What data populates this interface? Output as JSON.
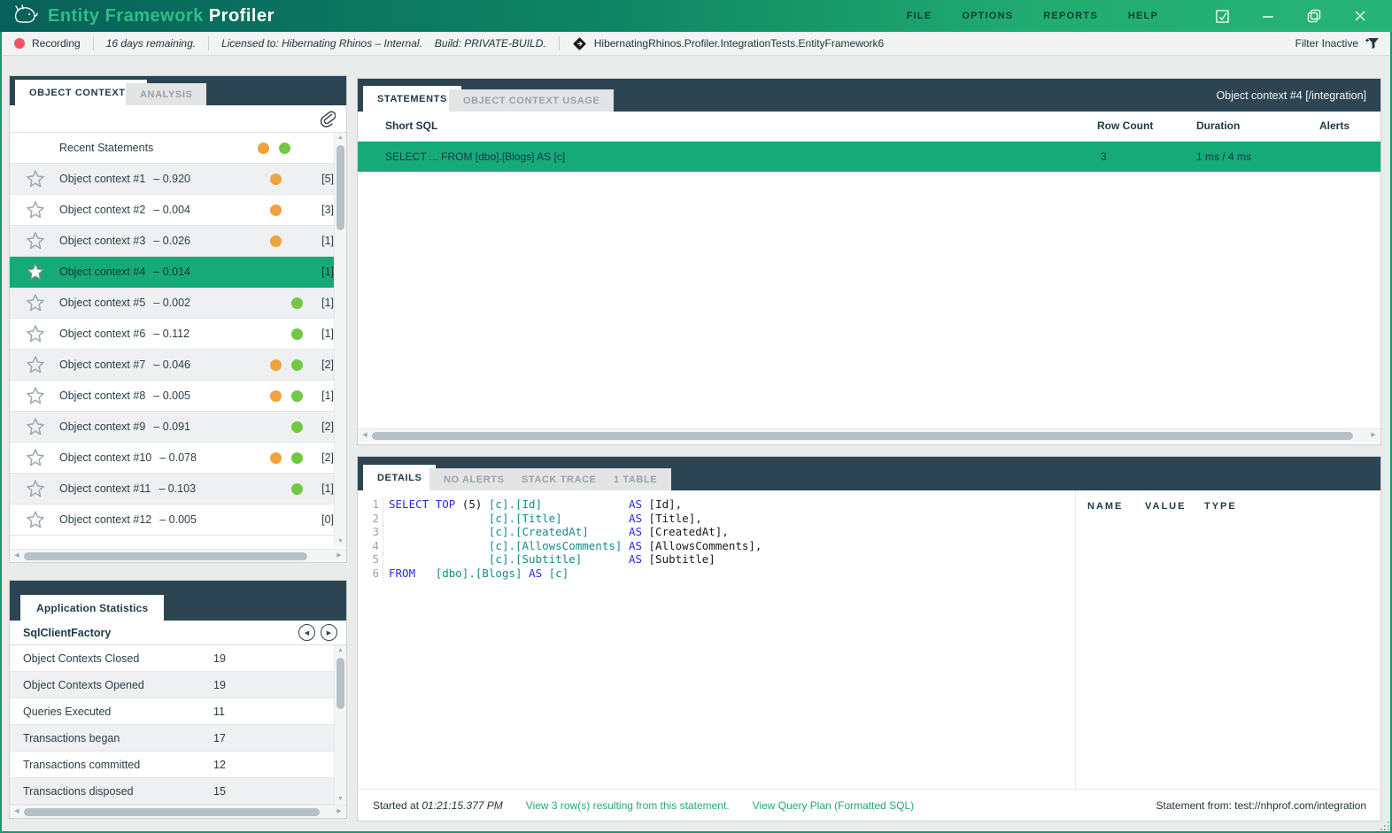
{
  "titlebar": {
    "brand_green": "Entity Framework",
    "brand_white": "Profiler",
    "menu": [
      "FILE",
      "OPTIONS",
      "REPORTS",
      "HELP"
    ]
  },
  "toolbar": {
    "recording_label": "Recording",
    "days_remaining": "16 days remaining.",
    "licensed": "Licensed to: Hibernating Rhinos – Internal.",
    "build": "Build: PRIVATE-BUILD.",
    "process": "HibernatingRhinos.Profiler.IntegrationTests.EntityFramework6",
    "filter_label": "Filter Inactive"
  },
  "contexts": {
    "tabs": [
      {
        "label": "OBJECT CONTEXTS",
        "active": true
      },
      {
        "label": "ANALYSIS",
        "active": false
      }
    ],
    "rows": [
      {
        "name": "Recent Statements",
        "metric": "",
        "count": "",
        "star_outline": false,
        "star_filled": false,
        "orange": true,
        "green": true,
        "selected": false
      },
      {
        "name": "Object context #1",
        "metric": "– 0.920",
        "count": "[5]",
        "star_outline": true,
        "star_filled": false,
        "orange": true,
        "green": false,
        "selected": false
      },
      {
        "name": "Object context #2",
        "metric": "– 0.004",
        "count": "[3]",
        "star_outline": true,
        "star_filled": false,
        "orange": true,
        "green": false,
        "selected": false
      },
      {
        "name": "Object context #3",
        "metric": "– 0.026",
        "count": "[1]",
        "star_outline": true,
        "star_filled": false,
        "orange": true,
        "green": false,
        "selected": false
      },
      {
        "name": "Object context #4",
        "metric": "– 0.014",
        "count": "[1]",
        "star_outline": false,
        "star_filled": true,
        "orange": false,
        "green": false,
        "selected": true
      },
      {
        "name": "Object context #5",
        "metric": "– 0.002",
        "count": "[1]",
        "star_outline": true,
        "star_filled": false,
        "orange": false,
        "green": true,
        "selected": false
      },
      {
        "name": "Object context #6",
        "metric": "– 0.112",
        "count": "[1]",
        "star_outline": true,
        "star_filled": false,
        "orange": false,
        "green": true,
        "selected": false
      },
      {
        "name": "Object context #7",
        "metric": "– 0.046",
        "count": "[2]",
        "star_outline": true,
        "star_filled": false,
        "orange": true,
        "green": true,
        "selected": false
      },
      {
        "name": "Object context #8",
        "metric": "– 0.005",
        "count": "[1]",
        "star_outline": true,
        "star_filled": false,
        "orange": true,
        "green": true,
        "selected": false
      },
      {
        "name": "Object context #9",
        "metric": "– 0.091",
        "count": "[2]",
        "star_outline": true,
        "star_filled": false,
        "orange": false,
        "green": true,
        "selected": false
      },
      {
        "name": "Object context #10",
        "metric": "– 0.078",
        "count": "[2]",
        "star_outline": true,
        "star_filled": false,
        "orange": true,
        "green": true,
        "selected": false
      },
      {
        "name": "Object context #11",
        "metric": "– 0.103",
        "count": "[1]",
        "star_outline": true,
        "star_filled": false,
        "orange": false,
        "green": true,
        "selected": false
      },
      {
        "name": "Object context #12",
        "metric": "– 0.005",
        "count": "[0]",
        "star_outline": true,
        "star_filled": false,
        "orange": false,
        "green": false,
        "selected": false
      }
    ]
  },
  "stats": {
    "tab_label": "Application Statistics",
    "provider": "SqlClientFactory",
    "rows": [
      {
        "label": "Object Contexts Closed",
        "value": "19"
      },
      {
        "label": "Object Contexts Opened",
        "value": "19"
      },
      {
        "label": "Queries Executed",
        "value": "11"
      },
      {
        "label": "Transactions began",
        "value": "17"
      },
      {
        "label": "Transactions committed",
        "value": "12"
      },
      {
        "label": "Transactions disposed",
        "value": "15"
      }
    ]
  },
  "statements": {
    "tab_statements": "STATEMENTS",
    "tab_usage": "OBJECT CONTEXT USAGE",
    "context_label": "Object context #4 [/integration]",
    "col_sql": "Short SQL",
    "col_rows": "Row Count",
    "col_duration": "Duration",
    "col_alerts": "Alerts",
    "row": {
      "sql": "SELECT ... FROM [dbo].[Blogs] AS [c]",
      "row_count": "3",
      "duration": "1 ms / 4 ms",
      "alerts": ""
    }
  },
  "details": {
    "tabs": {
      "details": "DETAILS",
      "alerts": "NO ALERTS",
      "stack": "STACK TRACE",
      "table": "1 TABLE"
    },
    "results": {
      "name": "NAME",
      "value": "VALUE",
      "type": "TYPE"
    },
    "sql_lines": [
      {
        "num": "1",
        "segs": [
          [
            "kw",
            "SELECT"
          ],
          [
            "pl",
            " "
          ],
          [
            "kw",
            "TOP"
          ],
          [
            "pl",
            " (5) "
          ],
          [
            "id",
            "[c].[Id]"
          ],
          [
            "pl",
            "             "
          ],
          [
            "kw",
            "AS"
          ],
          [
            "pl",
            " [Id],"
          ]
        ]
      },
      {
        "num": "2",
        "segs": [
          [
            "pl",
            "               "
          ],
          [
            "id",
            "[c].[Title]"
          ],
          [
            "pl",
            "          "
          ],
          [
            "kw",
            "AS"
          ],
          [
            "pl",
            " [Title],"
          ]
        ]
      },
      {
        "num": "3",
        "segs": [
          [
            "pl",
            "               "
          ],
          [
            "id",
            "[c].[CreatedAt]"
          ],
          [
            "pl",
            "      "
          ],
          [
            "kw",
            "AS"
          ],
          [
            "pl",
            " [CreatedAt],"
          ]
        ]
      },
      {
        "num": "4",
        "segs": [
          [
            "pl",
            "               "
          ],
          [
            "id",
            "[c].[AllowsComments]"
          ],
          [
            "pl",
            " "
          ],
          [
            "kw",
            "AS"
          ],
          [
            "pl",
            " [AllowsComments],"
          ]
        ]
      },
      {
        "num": "5",
        "segs": [
          [
            "pl",
            "               "
          ],
          [
            "id",
            "[c].[Subtitle]"
          ],
          [
            "pl",
            "       "
          ],
          [
            "kw",
            "AS"
          ],
          [
            "pl",
            " [Subtitle]"
          ]
        ]
      },
      {
        "num": "6",
        "segs": [
          [
            "kw",
            "FROM"
          ],
          [
            "pl",
            "   "
          ],
          [
            "id",
            "[dbo].[Blogs]"
          ],
          [
            "pl",
            " "
          ],
          [
            "kw",
            "AS"
          ],
          [
            "pl",
            " "
          ],
          [
            "id",
            "[c]"
          ]
        ]
      }
    ],
    "footer": {
      "started_prefix": "Started at ",
      "started_time": "01:21:15.377 PM",
      "rows_link": "View 3 row(s) resulting from this statement.",
      "plan_link": "View Query Plan (Formatted SQL)",
      "statement_from": "Statement from: test://nhprof.com/integration"
    }
  },
  "colors": {
    "accent_selection_green": "#17aa79",
    "alert_dot_orange": "#f0a23c",
    "ok_dot_green": "#71c845",
    "header_slate": "#2d4552",
    "recording_red": "#ef5466",
    "link_green": "#21a878",
    "sql_keyword_blue": "#2a2ae0",
    "sql_identifier_teal": "#148b8b"
  }
}
